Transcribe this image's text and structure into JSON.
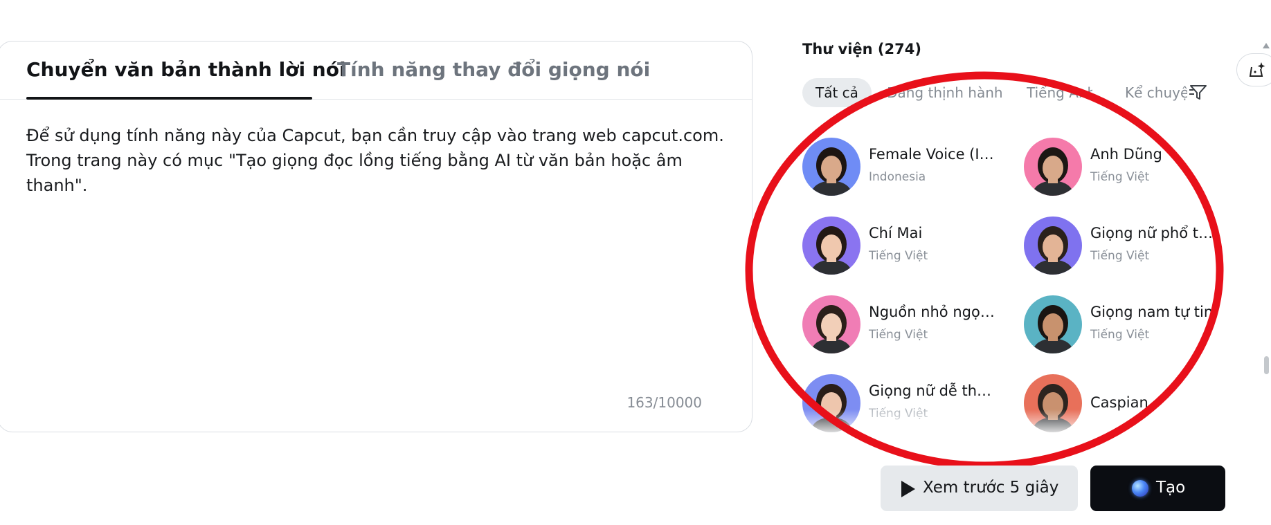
{
  "editor": {
    "tabs": [
      {
        "label": "Chuyển văn bản thành lời nói",
        "active": true
      },
      {
        "label": "Tính năng thay đổi giọng nói",
        "active": false
      }
    ],
    "text": "Để sử dụng tính năng này của Capcut, bạn cần truy cập vào trang web capcut.com. Trong trang này có mục \"Tạo giọng đọc lồng tiếng bằng AI từ văn bản hoặc âm thanh\".",
    "char_count": "163/10000"
  },
  "library": {
    "title": "Thư viện (274)",
    "filters": [
      "Tất cả",
      "Đang thịnh hành",
      "Tiếng Anh",
      "Kể chuyện"
    ],
    "filter_icon": "filter-icon",
    "voices": [
      {
        "name": "Female Voice (Indonesia)",
        "lang": "Indonesia",
        "bg": "#6f8cf5",
        "skin": "#d9a98a",
        "hair": "#1d1512"
      },
      {
        "name": "Anh Dũng",
        "lang": "Tiếng Việt",
        "bg": "#f57aaa",
        "skin": "#d8a98a",
        "hair": "#1c1714"
      },
      {
        "name": "Chí Mai",
        "lang": "Tiếng Việt",
        "bg": "#8a74f0",
        "skin": "#f0c8ae",
        "hair": "#231915"
      },
      {
        "name": "Giọng nữ phổ thông",
        "lang": "Tiếng Việt",
        "bg": "#7f72ef",
        "skin": "#e3b496",
        "hair": "#2a211c"
      },
      {
        "name": "Nguồn nhỏ ngọt ngào",
        "lang": "Tiếng Việt",
        "bg": "#f07db5",
        "skin": "#f2cfb8",
        "hair": "#2b1f1a"
      },
      {
        "name": "Giọng nam tự tin",
        "lang": "Tiếng Việt",
        "bg": "#5ab3c4",
        "skin": "#c8926e",
        "hair": "#1a1512"
      },
      {
        "name": "Giọng nữ dễ thương",
        "lang": "Tiếng Việt",
        "bg": "#7d8df2",
        "skin": "#eec6ad",
        "hair": "#2a1e18"
      },
      {
        "name": "Caspian",
        "lang": "",
        "bg": "#e8705a",
        "skin": "#c9916f",
        "hair": "#2c241f"
      }
    ]
  },
  "buttons": {
    "preview": "Xem trước 5 giây",
    "create": "Tạo"
  },
  "annotation_color": "#e8101a"
}
